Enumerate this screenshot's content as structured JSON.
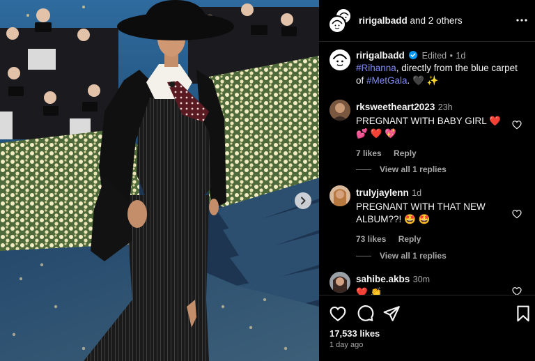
{
  "post": {
    "photo_alt": "Rihanna at the Met Gala blue carpet",
    "next_icon": "chevron-right-icon"
  },
  "header": {
    "username": "ririgalbadd",
    "others": "and 2 others",
    "more_icon": "ellipsis-icon"
  },
  "caption": {
    "username": "ririgalbadd",
    "edited": "Edited",
    "dot": "•",
    "time": "1d",
    "tag1": "#Rihanna",
    "text1": ", directly from the blue carpet of ",
    "tag2": "#MetGala",
    "text2": ". 🖤 ✨"
  },
  "comments": [
    {
      "username": "rksweetheart2023",
      "time": "23h",
      "text": "PREGNANT WITH BABY GIRL ❤️ 💕 ❤️ 💖",
      "likes": "7 likes",
      "reply": "Reply",
      "view_replies": "View all 1 replies"
    },
    {
      "username": "trulyjaylenn",
      "time": "1d",
      "text": "PREGNANT WITH THAT NEW ALBUM??! 🤩 🤩",
      "likes": "73 likes",
      "reply": "Reply",
      "view_replies": "View all 1 replies"
    },
    {
      "username": "sahibe.akbs",
      "time": "30m",
      "text": "❤️ 👏"
    }
  ],
  "actions": {
    "like_icon": "heart-icon",
    "comment_icon": "comment-icon",
    "share_icon": "paper-plane-icon",
    "save_icon": "bookmark-icon",
    "likes_count": "17,533 likes",
    "time_ago": "1 day ago"
  },
  "colors": {
    "background": "#000000",
    "text": "#f5f5f5",
    "muted": "#a8a8a8",
    "link": "#7f8cf5",
    "verified": "#0095f6",
    "carpet": "#1d3550"
  }
}
